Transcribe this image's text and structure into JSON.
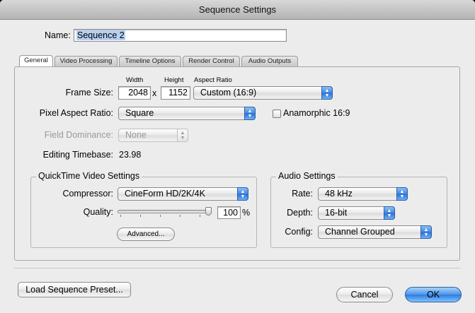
{
  "window": {
    "title": "Sequence Settings"
  },
  "name": {
    "label": "Name:",
    "value": "Sequence 2"
  },
  "tabs": [
    {
      "label": "General",
      "active": true
    },
    {
      "label": "Video Processing",
      "active": false
    },
    {
      "label": "Timeline Options",
      "active": false
    },
    {
      "label": "Render Control",
      "active": false
    },
    {
      "label": "Audio Outputs",
      "active": false
    }
  ],
  "general": {
    "width_header": "Width",
    "height_header": "Height",
    "aspect_header": "Aspect Ratio",
    "frame_size_label": "Frame Size:",
    "width_value": "2048",
    "times_symbol": "x",
    "height_value": "1152",
    "aspect_ratio_value": "Custom (16:9)",
    "pixel_aspect_label": "Pixel Aspect Ratio:",
    "pixel_aspect_value": "Square",
    "anamorphic_label": "Anamorphic 16:9",
    "anamorphic_checked": false,
    "field_dominance_label": "Field Dominance:",
    "field_dominance_value": "None",
    "editing_timebase_label": "Editing Timebase:",
    "editing_timebase_value": "23.98"
  },
  "quicktime": {
    "title": "QuickTime Video Settings",
    "compressor_label": "Compressor:",
    "compressor_value": "CineForm HD/2K/4K",
    "quality_label": "Quality:",
    "quality_value": "100",
    "quality_unit": "%",
    "quality_fraction": 1.0,
    "advanced_button": "Advanced..."
  },
  "audio": {
    "title": "Audio Settings",
    "rate_label": "Rate:",
    "rate_value": "48 kHz",
    "depth_label": "Depth:",
    "depth_value": "16-bit",
    "config_label": "Config:",
    "config_value": "Channel Grouped"
  },
  "footer": {
    "load_preset_button": "Load Sequence Preset...",
    "cancel_button": "Cancel",
    "ok_button": "OK"
  },
  "colors": {
    "accent": "#3f86e0",
    "selection": "#b5d0f2",
    "window_bg": "#ececec"
  },
  "icons": {
    "popup_arrows": "up-down-arrows-icon",
    "slider": "slider-thumb-icon"
  }
}
